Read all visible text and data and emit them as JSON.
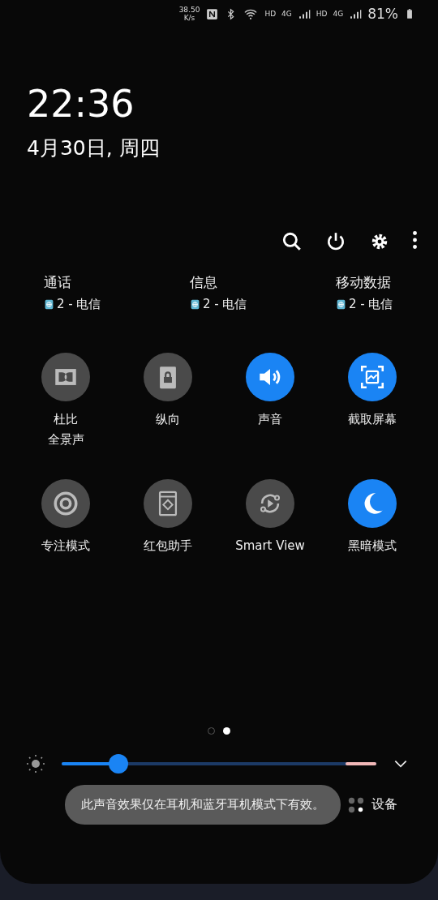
{
  "status_bar": {
    "speed": "38.50",
    "speed_unit": "K/s",
    "network_1": "4G",
    "network_2": "4G",
    "hd_1": "HD",
    "hd_2": "HD",
    "battery": "81%"
  },
  "clock": {
    "time": "22:36",
    "date": "4月30日, 周四"
  },
  "sim_preferences": [
    {
      "label": "通话",
      "sim": "2 - 电信"
    },
    {
      "label": "信息",
      "sim": "2 - 电信"
    },
    {
      "label": "移动数据",
      "sim": "2 - 电信"
    }
  ],
  "tiles": [
    {
      "label": [
        "杜比",
        "全景声"
      ],
      "on": false
    },
    {
      "label": [
        "纵向"
      ],
      "on": false
    },
    {
      "label": [
        "声音"
      ],
      "on": true
    },
    {
      "label": [
        "截取屏幕"
      ],
      "on": true
    },
    {
      "label": [
        "专注模式"
      ],
      "on": false
    },
    {
      "label": [
        "红包助手"
      ],
      "on": false
    },
    {
      "label": [
        "Smart View"
      ],
      "on": false
    },
    {
      "label": [
        "黑暗模式"
      ],
      "on": true
    }
  ],
  "page_dots": [
    {
      "selected": false
    },
    {
      "selected": true
    }
  ],
  "brightness": {
    "level": 0.18
  },
  "toast": "此声音效果仅在耳机和蓝牙耳机模式下有效。",
  "devices_button": "设备"
}
